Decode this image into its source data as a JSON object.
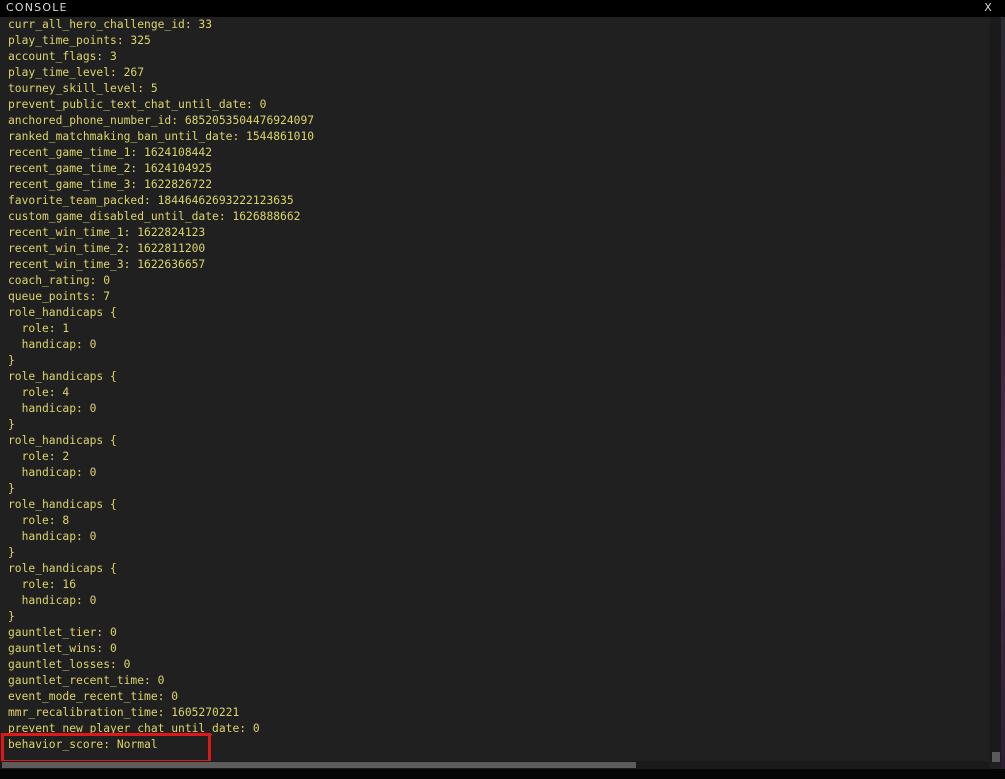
{
  "window": {
    "title": "CONSOLE",
    "close_label": "X"
  },
  "console": {
    "lines": [
      "curr_all_hero_challenge_id: 33",
      "play_time_points: 325",
      "account_flags: 3",
      "play_time_level: 267",
      "tourney_skill_level: 5",
      "prevent_public_text_chat_until_date: 0",
      "anchored_phone_number_id: 6852053504476924097",
      "ranked_matchmaking_ban_until_date: 1544861010",
      "recent_game_time_1: 1624108442",
      "recent_game_time_2: 1624104925",
      "recent_game_time_3: 1622826722",
      "favorite_team_packed: 18446462693222123635",
      "custom_game_disabled_until_date: 1626888662",
      "recent_win_time_1: 1622824123",
      "recent_win_time_2: 1622811200",
      "recent_win_time_3: 1622636657",
      "coach_rating: 0",
      "queue_points: 7",
      "role_handicaps {",
      "  role: 1",
      "  handicap: 0",
      "}",
      "role_handicaps {",
      "  role: 4",
      "  handicap: 0",
      "}",
      "role_handicaps {",
      "  role: 2",
      "  handicap: 0",
      "}",
      "role_handicaps {",
      "  role: 8",
      "  handicap: 0",
      "}",
      "role_handicaps {",
      "  role: 16",
      "  handicap: 0",
      "}",
      "gauntlet_tier: 0",
      "gauntlet_wins: 0",
      "gauntlet_losses: 0",
      "gauntlet_recent_time: 0",
      "event_mode_recent_time: 0",
      "mmr_recalibration_time: 1605270221",
      "prevent_new_player_chat_until_date: 0",
      "behavior_score: Normal"
    ]
  },
  "colors": {
    "text": "#ddd46a",
    "background": "#202020",
    "highlight_border": "#e01818"
  }
}
